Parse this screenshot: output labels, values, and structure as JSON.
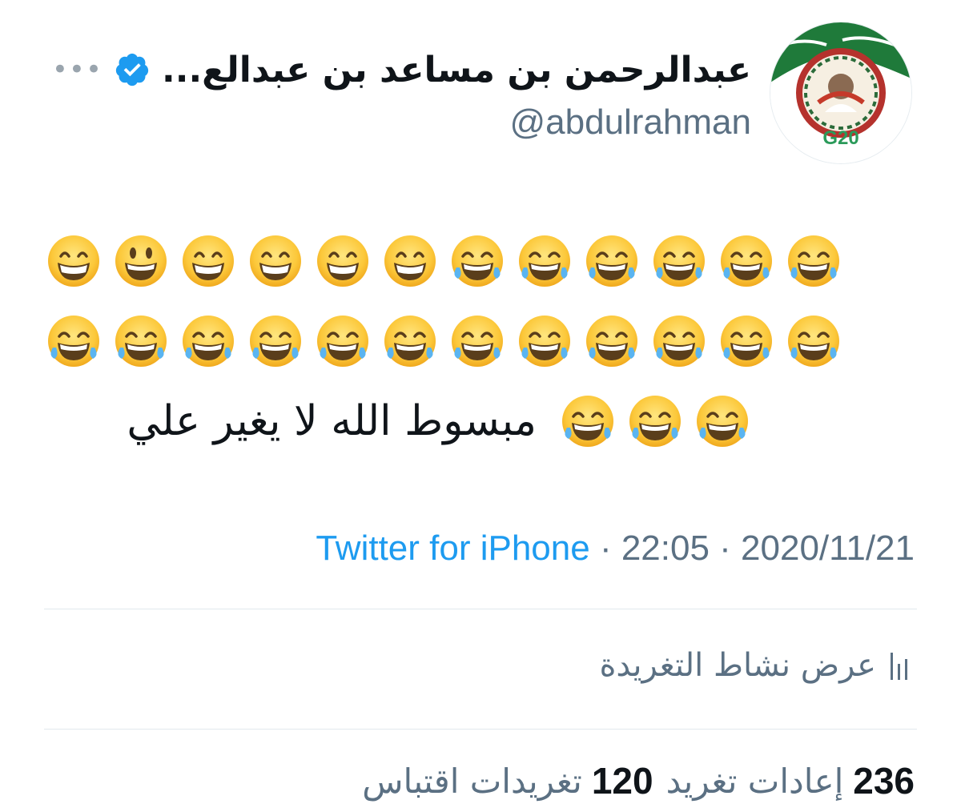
{
  "author": {
    "display_name": "عبدالرحمن بن مساعد بن عبدالع...",
    "handle": "@abdulrahman",
    "verified": true,
    "avatar_text": "G20"
  },
  "tweet": {
    "text": "مبسوط الله لا يغير علي",
    "source": "Twitter for iPhone",
    "time": "22:05",
    "date": "2020/11/21",
    "separator": " · "
  },
  "actions": {
    "activity_label": "عرض نشاط التغريدة"
  },
  "stats": {
    "retweets_count": "236",
    "retweets_label": "إعادات تغريد",
    "quotes_count": "120",
    "quotes_label": "تغريدات اقتباس"
  },
  "colors": {
    "link_blue": "#1d9bf0",
    "secondary": "#5b7083",
    "verified_blue": "#1d9bf0"
  }
}
